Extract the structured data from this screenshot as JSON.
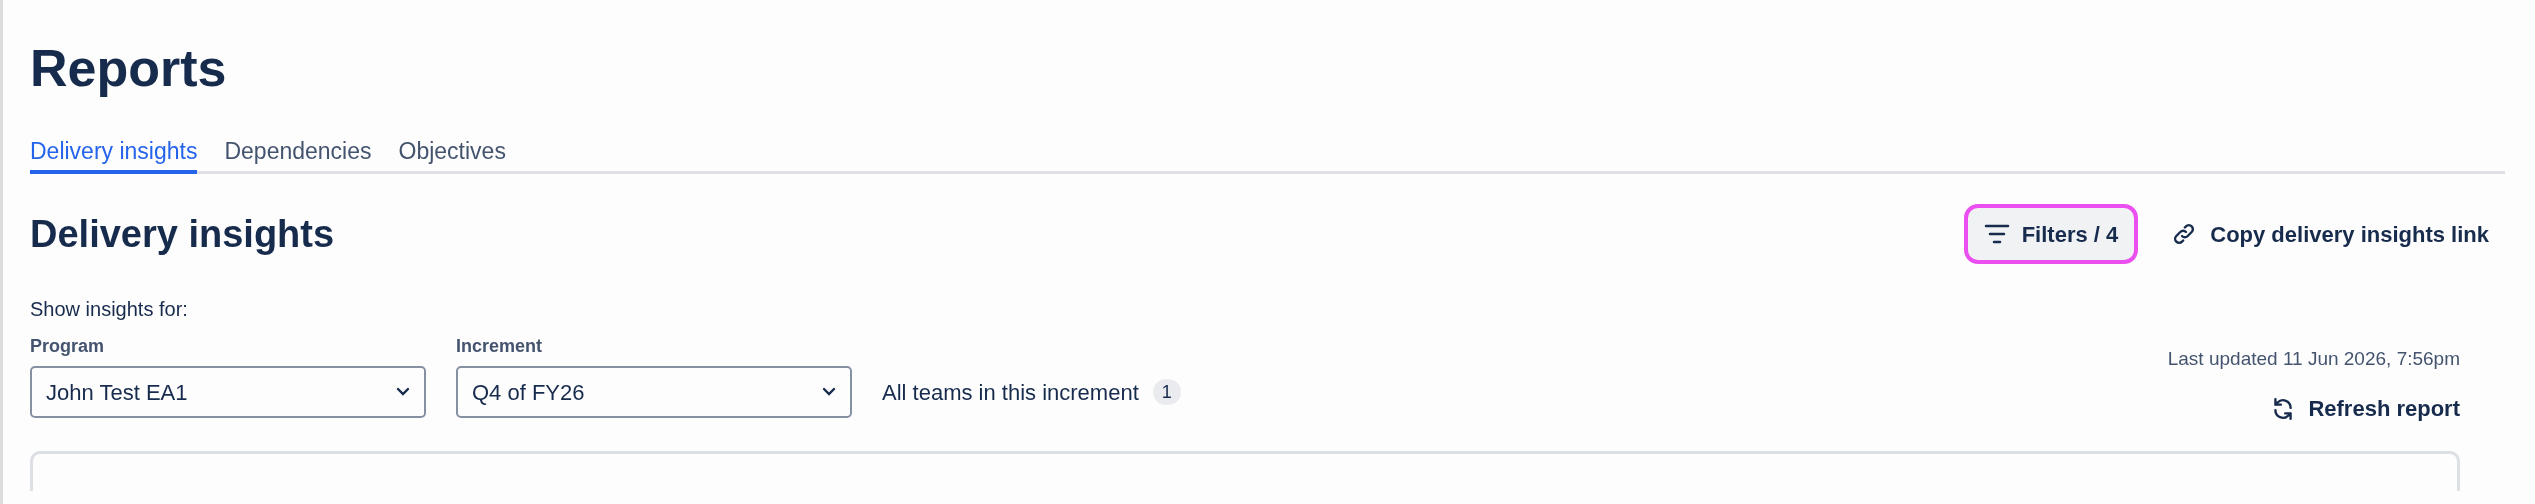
{
  "page_title": "Reports",
  "tabs": [
    {
      "label": "Delivery insights",
      "selected": true
    },
    {
      "label": "Dependencies",
      "selected": false
    },
    {
      "label": "Objectives",
      "selected": false
    }
  ],
  "section_title": "Delivery insights",
  "filters_button": {
    "label": "Filters / 4",
    "focused": true
  },
  "copy_link": "Copy delivery insights link",
  "show_insights_label": "Show insights for:",
  "selects": [
    {
      "label": "Program",
      "value": "John Test EA1"
    },
    {
      "label": "Increment",
      "value": "Q4 of FY26"
    }
  ],
  "teams": {
    "label": "All teams in this increment",
    "count": "1"
  },
  "last_updated": "Last updated 11 Jun 2026, 7:56pm",
  "refresh_button": "Refresh report"
}
